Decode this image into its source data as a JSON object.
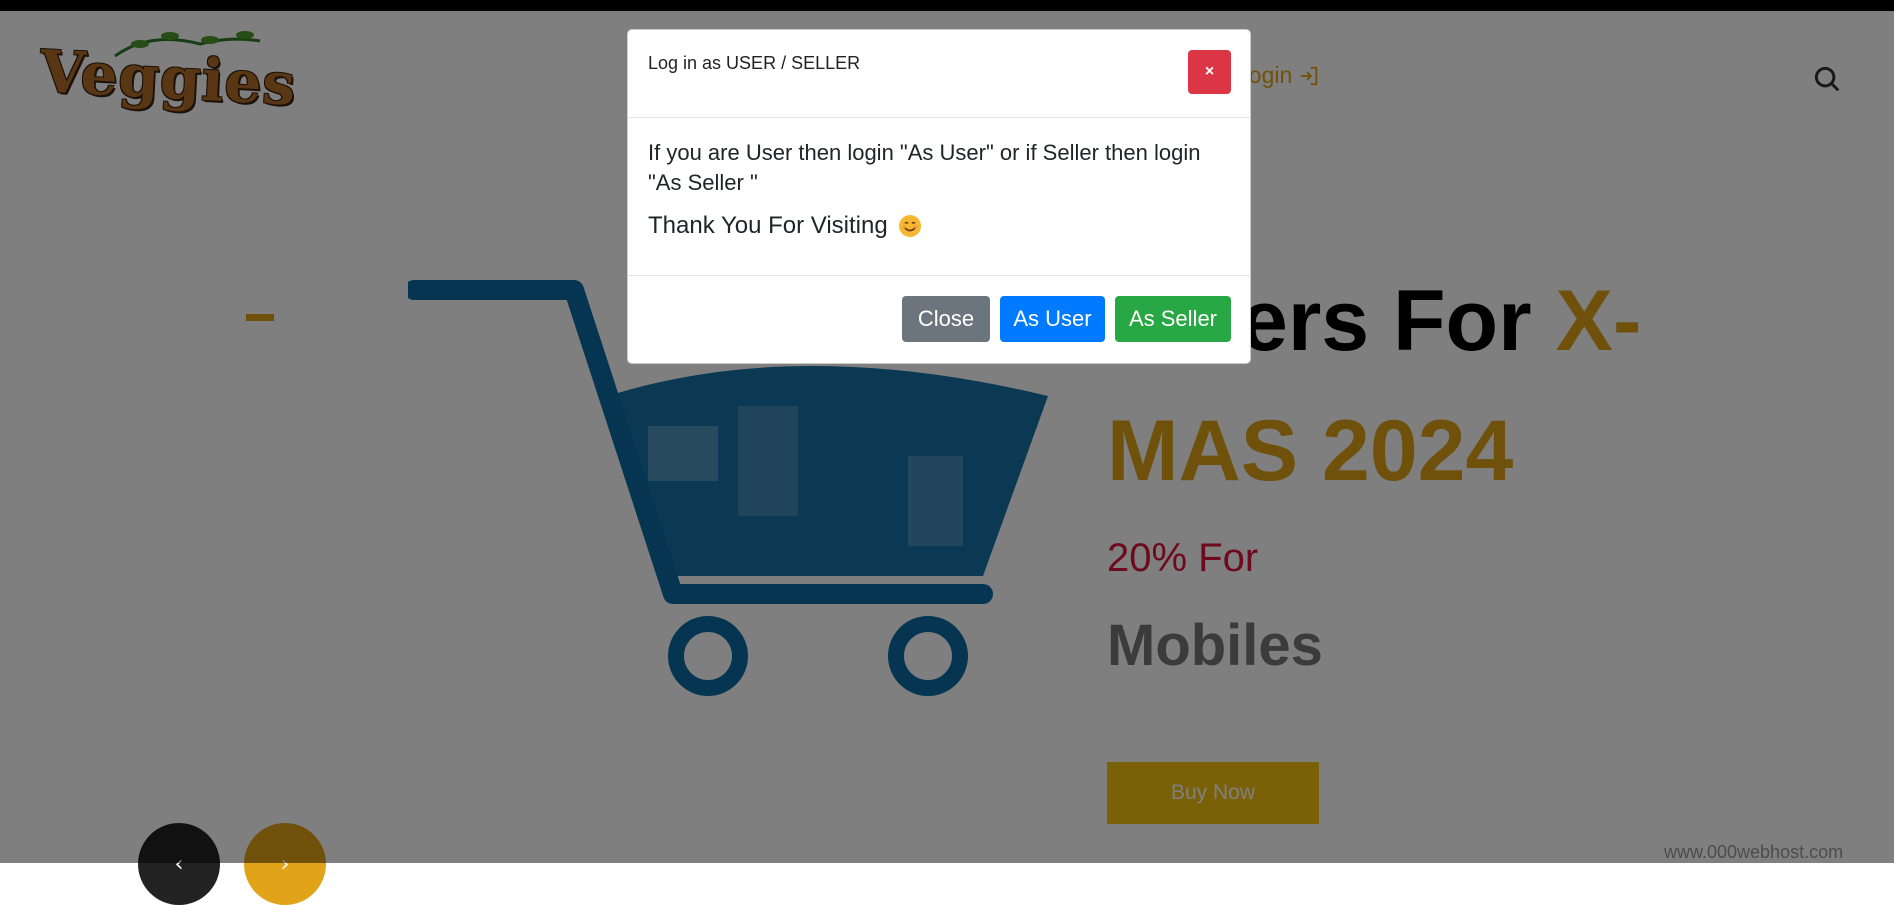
{
  "header": {
    "logo_text": "Veggies",
    "nav_login_label": "Login",
    "search_icon": "search-icon"
  },
  "hero": {
    "line1_text": "ers For ",
    "line1_accent": "X-",
    "line2_text": "MAS 2024",
    "discount_text": "20% For",
    "product_text": "Mobiles",
    "buy_now_label": "Buy Now",
    "prev_icon": "arrow-left-icon",
    "next_icon": "arrow-right-icon"
  },
  "footer": {
    "webhost_text": "www.000webhost.com"
  },
  "modal": {
    "title": "Log in as USER / SELLER",
    "close_x_label": "×",
    "message": "If you are User then login \"As User\" or if Seller then login \"As Seller \"",
    "thanks": "Thank You For Visiting",
    "buttons": {
      "close": "Close",
      "as_user": "As User",
      "as_seller": "As Seller"
    }
  },
  "colors": {
    "accent": "#e0a319",
    "danger": "#dc3545",
    "primary": "#007bff",
    "success": "#28a745",
    "secondary": "#6c757d",
    "cart": "#0b6aa2"
  }
}
